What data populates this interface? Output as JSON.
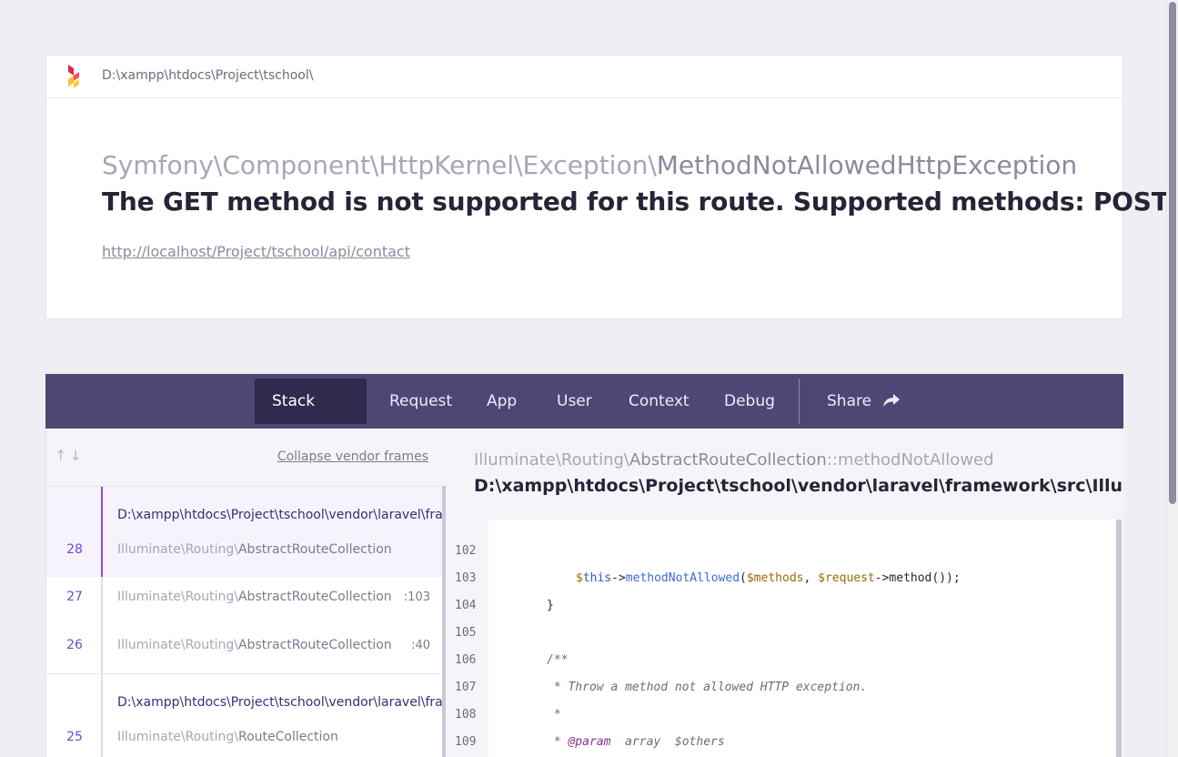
{
  "header": {
    "path": "D:\\xampp\\htdocs\\Project\\tschool\\",
    "exception_namespace": "Symfony\\Component\\HttpKernel\\Exception\\",
    "exception_class": "MethodNotAllowedHttpException",
    "message": "The GET method is not supported for this route. Supported methods: POST.",
    "url": "http://localhost/Project/tschool/api/contact"
  },
  "tabs": [
    {
      "label": "Stack trace",
      "active": true
    },
    {
      "label": "Request"
    },
    {
      "label": "App"
    },
    {
      "label": "User"
    },
    {
      "label": "Context"
    },
    {
      "label": "Debug"
    },
    {
      "label": "Share"
    }
  ],
  "frames_panel": {
    "collapse_label": "Collapse vendor frames",
    "frames": [
      {
        "number": "28",
        "file": "D:\\xampp\\htdocs\\Project\\tschool\\vendor\\laravel\\framework\\src\\Illuminate\\Routing\\AbstractRouteCollection.php",
        "namespace": "Illuminate\\Routing\\",
        "class": "AbstractRouteCollection",
        "line": ""
      },
      {
        "number": "27",
        "namespace": "Illuminate\\Routing\\",
        "class": "AbstractRouteCollection",
        "line": ":103"
      },
      {
        "number": "26",
        "namespace": "Illuminate\\Routing\\",
        "class": "AbstractRouteCollection",
        "line": ":40"
      },
      {
        "number": "25",
        "file": "D:\\xampp\\htdocs\\Project\\tschool\\vendor\\laravel\\framework\\src\\Illuminate\\Routing\\RouteCollection.php",
        "namespace": "Illuminate\\Routing\\",
        "class": "RouteCollection",
        "line": ""
      }
    ]
  },
  "code_panel": {
    "namespace": "Illuminate\\Routing\\",
    "class": "AbstractRouteCollection",
    "method": "::methodNotAllowed",
    "file": "D:\\xampp\\htdocs\\Project\\tschool\\vendor\\laravel\\framework\\src\\Illuminate\\Routing\\AbstractRouteCollection.php",
    "line_numbers": [
      "102",
      "103",
      "104",
      "105",
      "106",
      "107",
      "108",
      "109"
    ]
  }
}
